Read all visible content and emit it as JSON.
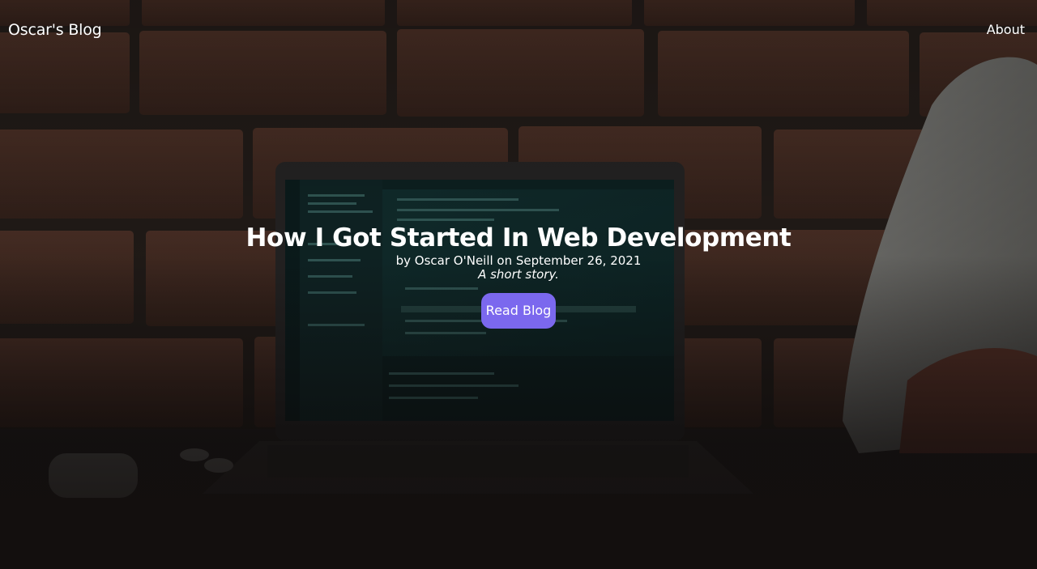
{
  "nav": {
    "brand": "Oscar's Blog",
    "about": "About"
  },
  "hero": {
    "title": "How I Got Started In Web Development",
    "byline": "by Oscar O'Neill on September 26, 2021",
    "tagline": "A short story.",
    "cta_label": "Read Blog"
  },
  "colors": {
    "accent": "#7b68ee",
    "text": "#ffffff"
  },
  "background_image": "brick-wall-laptop-code-editor-sneaker-photo"
}
